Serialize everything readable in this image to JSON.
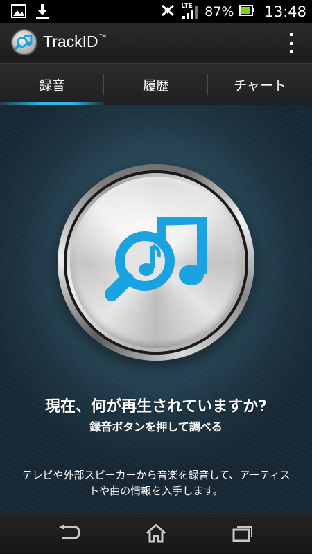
{
  "status_bar": {
    "battery_percent": "87%",
    "time": "13:48",
    "network_label": "LTE",
    "battery_level": 0.87,
    "icons": [
      "gallery-icon",
      "download-icon",
      "nfc-icon",
      "lte-signal-icon",
      "battery-icon"
    ]
  },
  "app_bar": {
    "title": "TrackID",
    "trademark": "™",
    "icons": [
      "trackid-app-icon",
      "overflow-menu-icon"
    ]
  },
  "tabs": [
    {
      "label": "録音",
      "selected": true
    },
    {
      "label": "履歴",
      "selected": false
    },
    {
      "label": "チャート",
      "selected": false
    }
  ],
  "main": {
    "record_button_icon": "music-search-icon",
    "headline": "現在、何が再生されていますか?",
    "subhead": "録音ボタンを押して調べる",
    "description": "テレビや外部スピーカーから音楽を録音して、アーティストや曲の情報を入手します。"
  },
  "nav_bar": {
    "icons": [
      "back-icon",
      "home-icon",
      "recent-apps-icon"
    ]
  },
  "colors": {
    "accent": "#33b5e5",
    "icon_blue": "#1aa3e0",
    "battery_green": "#7ed321",
    "background_teal": "#2c4d5d"
  }
}
